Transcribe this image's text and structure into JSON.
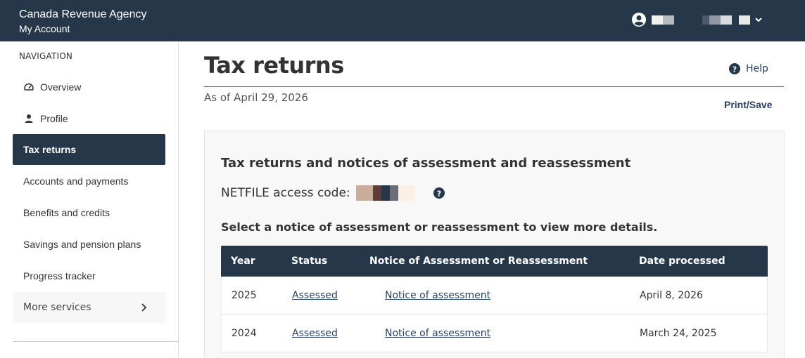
{
  "header": {
    "agency": "Canada Revenue Agency",
    "product": "My Account",
    "user_icon": "account-circle-icon",
    "redacted_blocks": [
      "#e0e0e0",
      "#26374a",
      "#26374a",
      "#26374a",
      "#26374a",
      "#5e6a78",
      "#9aa1aa",
      "#e6e6e6",
      "#26374a",
      "#e6e6e6"
    ]
  },
  "sidebar": {
    "heading": "NAVIGATION",
    "items": [
      {
        "label": "Overview",
        "icon": "speedometer-icon"
      },
      {
        "label": "Profile",
        "icon": "person-icon"
      },
      {
        "label": "Tax returns",
        "active": true
      },
      {
        "label": "Accounts and payments"
      },
      {
        "label": "Benefits and credits"
      },
      {
        "label": "Savings and pension plans"
      },
      {
        "label": "Progress tracker"
      },
      {
        "label": "More services",
        "icon": "chevron-right-icon"
      }
    ]
  },
  "main": {
    "title": "Tax returns",
    "help_label": "Help",
    "as_of": "As of April 29, 2026",
    "print_save": "Print/Save",
    "card": {
      "title": "Tax returns and notices of assessment and reassessment",
      "netfile_label": "NETFILE access code:",
      "netfile_redacted_colors": [
        "#c9ad9b",
        "#c9ad9b",
        "#5c3d38",
        "#26374a",
        "#6a6f77",
        "#fbf0e6",
        "#fbf0e6"
      ],
      "instruction": "Select a notice of assessment or reassessment to view more details.",
      "table": {
        "headers": [
          "Year",
          "Status",
          "Notice of Assessment or Reassessment",
          "Date processed"
        ],
        "rows": [
          {
            "year": "2025",
            "status": "Assessed",
            "notice": "Notice of assessment",
            "date": "April 8, 2026"
          },
          {
            "year": "2024",
            "status": "Assessed",
            "notice": "Notice of assessment",
            "date": "March 24, 2025"
          }
        ]
      }
    }
  },
  "colors": {
    "brand_navy": "#26374a",
    "title_rule": "#af3c43",
    "link": "#284162"
  }
}
